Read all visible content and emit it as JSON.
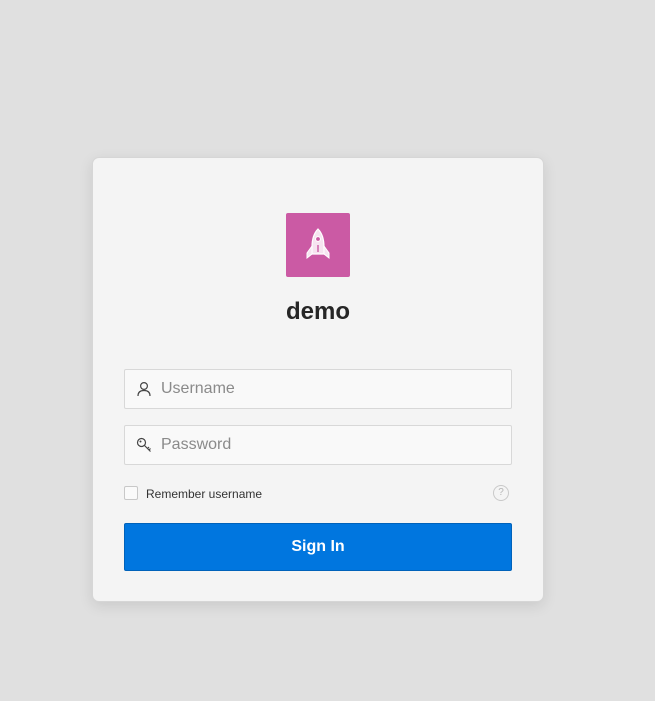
{
  "app": {
    "title": "demo",
    "logo_icon": "rocket-icon",
    "logo_color": "#cb5aa4"
  },
  "form": {
    "username": {
      "placeholder": "Username",
      "value": "",
      "icon": "user-icon"
    },
    "password": {
      "placeholder": "Password",
      "value": "",
      "icon": "key-icon"
    },
    "remember": {
      "label": "Remember username",
      "checked": false
    },
    "help_icon": "help-icon",
    "help_glyph": "?",
    "submit_label": "Sign In"
  },
  "colors": {
    "background": "#e0e0e0",
    "card": "#f4f4f4",
    "primary": "#0076df"
  }
}
